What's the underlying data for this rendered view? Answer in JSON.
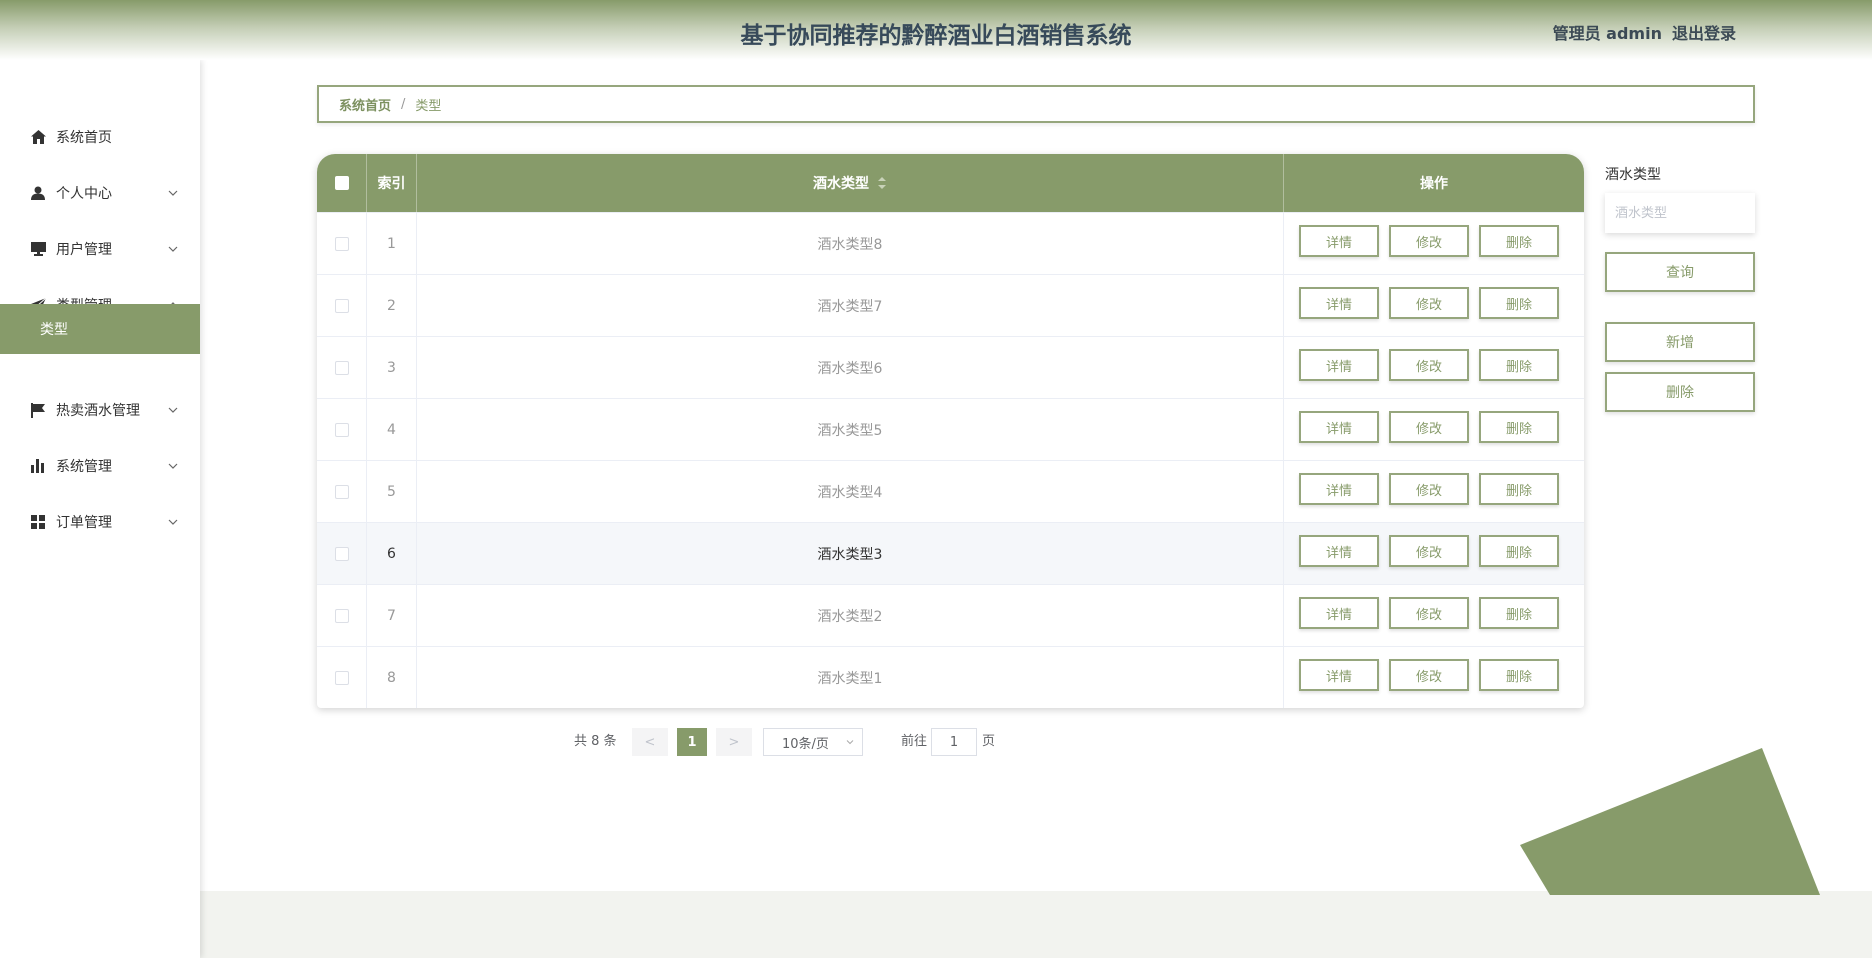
{
  "header": {
    "title": "基于协同推荐的黔醉酒业白酒销售系统",
    "user": "管理员 admin",
    "logout": "退出登录"
  },
  "sidebar": {
    "items": [
      {
        "label": "系统首页",
        "icon": "home-icon"
      },
      {
        "label": "个人中心",
        "icon": "user-icon",
        "expanded": false
      },
      {
        "label": "用户管理",
        "icon": "monitor-icon",
        "expanded": false
      },
      {
        "label": "类型管理",
        "icon": "send-icon",
        "expanded": true
      },
      {
        "label": "热卖酒水管理",
        "icon": "flag-icon",
        "expanded": false
      },
      {
        "label": "系统管理",
        "icon": "bar-chart-icon",
        "expanded": false
      },
      {
        "label": "订单管理",
        "icon": "grid-icon",
        "expanded": false
      }
    ],
    "active_sub": "类型"
  },
  "breadcrumb": {
    "home": "系统首页",
    "separator": "/",
    "current": "类型"
  },
  "table": {
    "columns": {
      "index": "索引",
      "type": "酒水类型",
      "actions": "操作"
    },
    "rows": [
      {
        "index": "1",
        "type": "酒水类型8"
      },
      {
        "index": "2",
        "type": "酒水类型7"
      },
      {
        "index": "3",
        "type": "酒水类型6"
      },
      {
        "index": "4",
        "type": "酒水类型5"
      },
      {
        "index": "5",
        "type": "酒水类型4"
      },
      {
        "index": "6",
        "type": "酒水类型3"
      },
      {
        "index": "7",
        "type": "酒水类型2"
      },
      {
        "index": "8",
        "type": "酒水类型1"
      }
    ],
    "highlighted_row": 6,
    "actions": {
      "detail": "详情",
      "edit": "修改",
      "delete": "删除"
    }
  },
  "search": {
    "label": "酒水类型",
    "placeholder": "酒水类型",
    "query_button": "查询",
    "add_button": "新增",
    "delete_button": "删除"
  },
  "pagination": {
    "total": "共 8 条",
    "prev": "<",
    "current_page": "1",
    "next": ">",
    "page_size": "10条/页",
    "goto_label": "前往",
    "goto_value": "1",
    "page_suffix": "页"
  },
  "colors": {
    "accent": "#879b6a",
    "header_text": "#374a5a",
    "border": "#96a67d"
  }
}
